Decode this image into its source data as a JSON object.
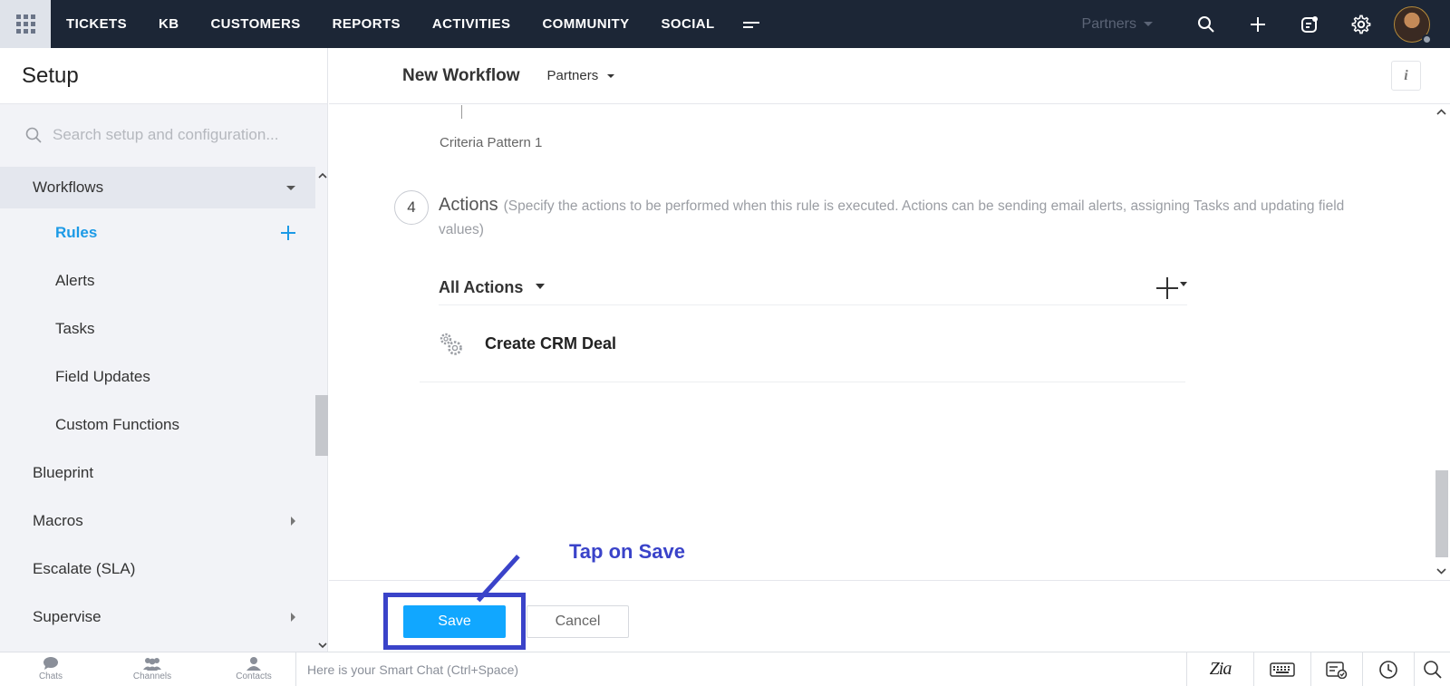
{
  "topnav": {
    "items": [
      "TICKETS",
      "KB",
      "CUSTOMERS",
      "REPORTS",
      "ACTIVITIES",
      "COMMUNITY",
      "SOCIAL"
    ],
    "department": "Partners",
    "icons": [
      "search-icon",
      "plus-icon",
      "notes-icon",
      "gear-icon"
    ]
  },
  "sidebar": {
    "title": "Setup",
    "search_placeholder": "Search setup and configuration...",
    "group": "Workflows",
    "sub_items": [
      "Rules",
      "Alerts",
      "Tasks",
      "Field Updates",
      "Custom Functions"
    ],
    "items": [
      "Blueprint",
      "Macros",
      "Escalate (SLA)",
      "Supervise"
    ]
  },
  "main": {
    "title": "New Workflow",
    "department": "Partners",
    "info_label": "i",
    "criteria_pattern": "Criteria Pattern 1",
    "step_number": "4",
    "actions_title": "Actions",
    "actions_desc": "(Specify the actions to be performed when this rule is executed. Actions can be sending email alerts, assigning Tasks and updating field values)",
    "all_actions_label": "All Actions",
    "action_item": "Create CRM Deal",
    "save_label": "Save",
    "cancel_label": "Cancel"
  },
  "annotation": {
    "callout": "Tap on Save",
    "color": "#3a43c9"
  },
  "bottombar": {
    "tabs": [
      "Chats",
      "Channels",
      "Contacts"
    ],
    "chat_placeholder": "Here is your Smart Chat (Ctrl+Space)",
    "zia_label": "Zia"
  },
  "colors": {
    "nav_bg": "#1c2636",
    "accent": "#1c9ae6",
    "save_button": "#11a7ff"
  }
}
